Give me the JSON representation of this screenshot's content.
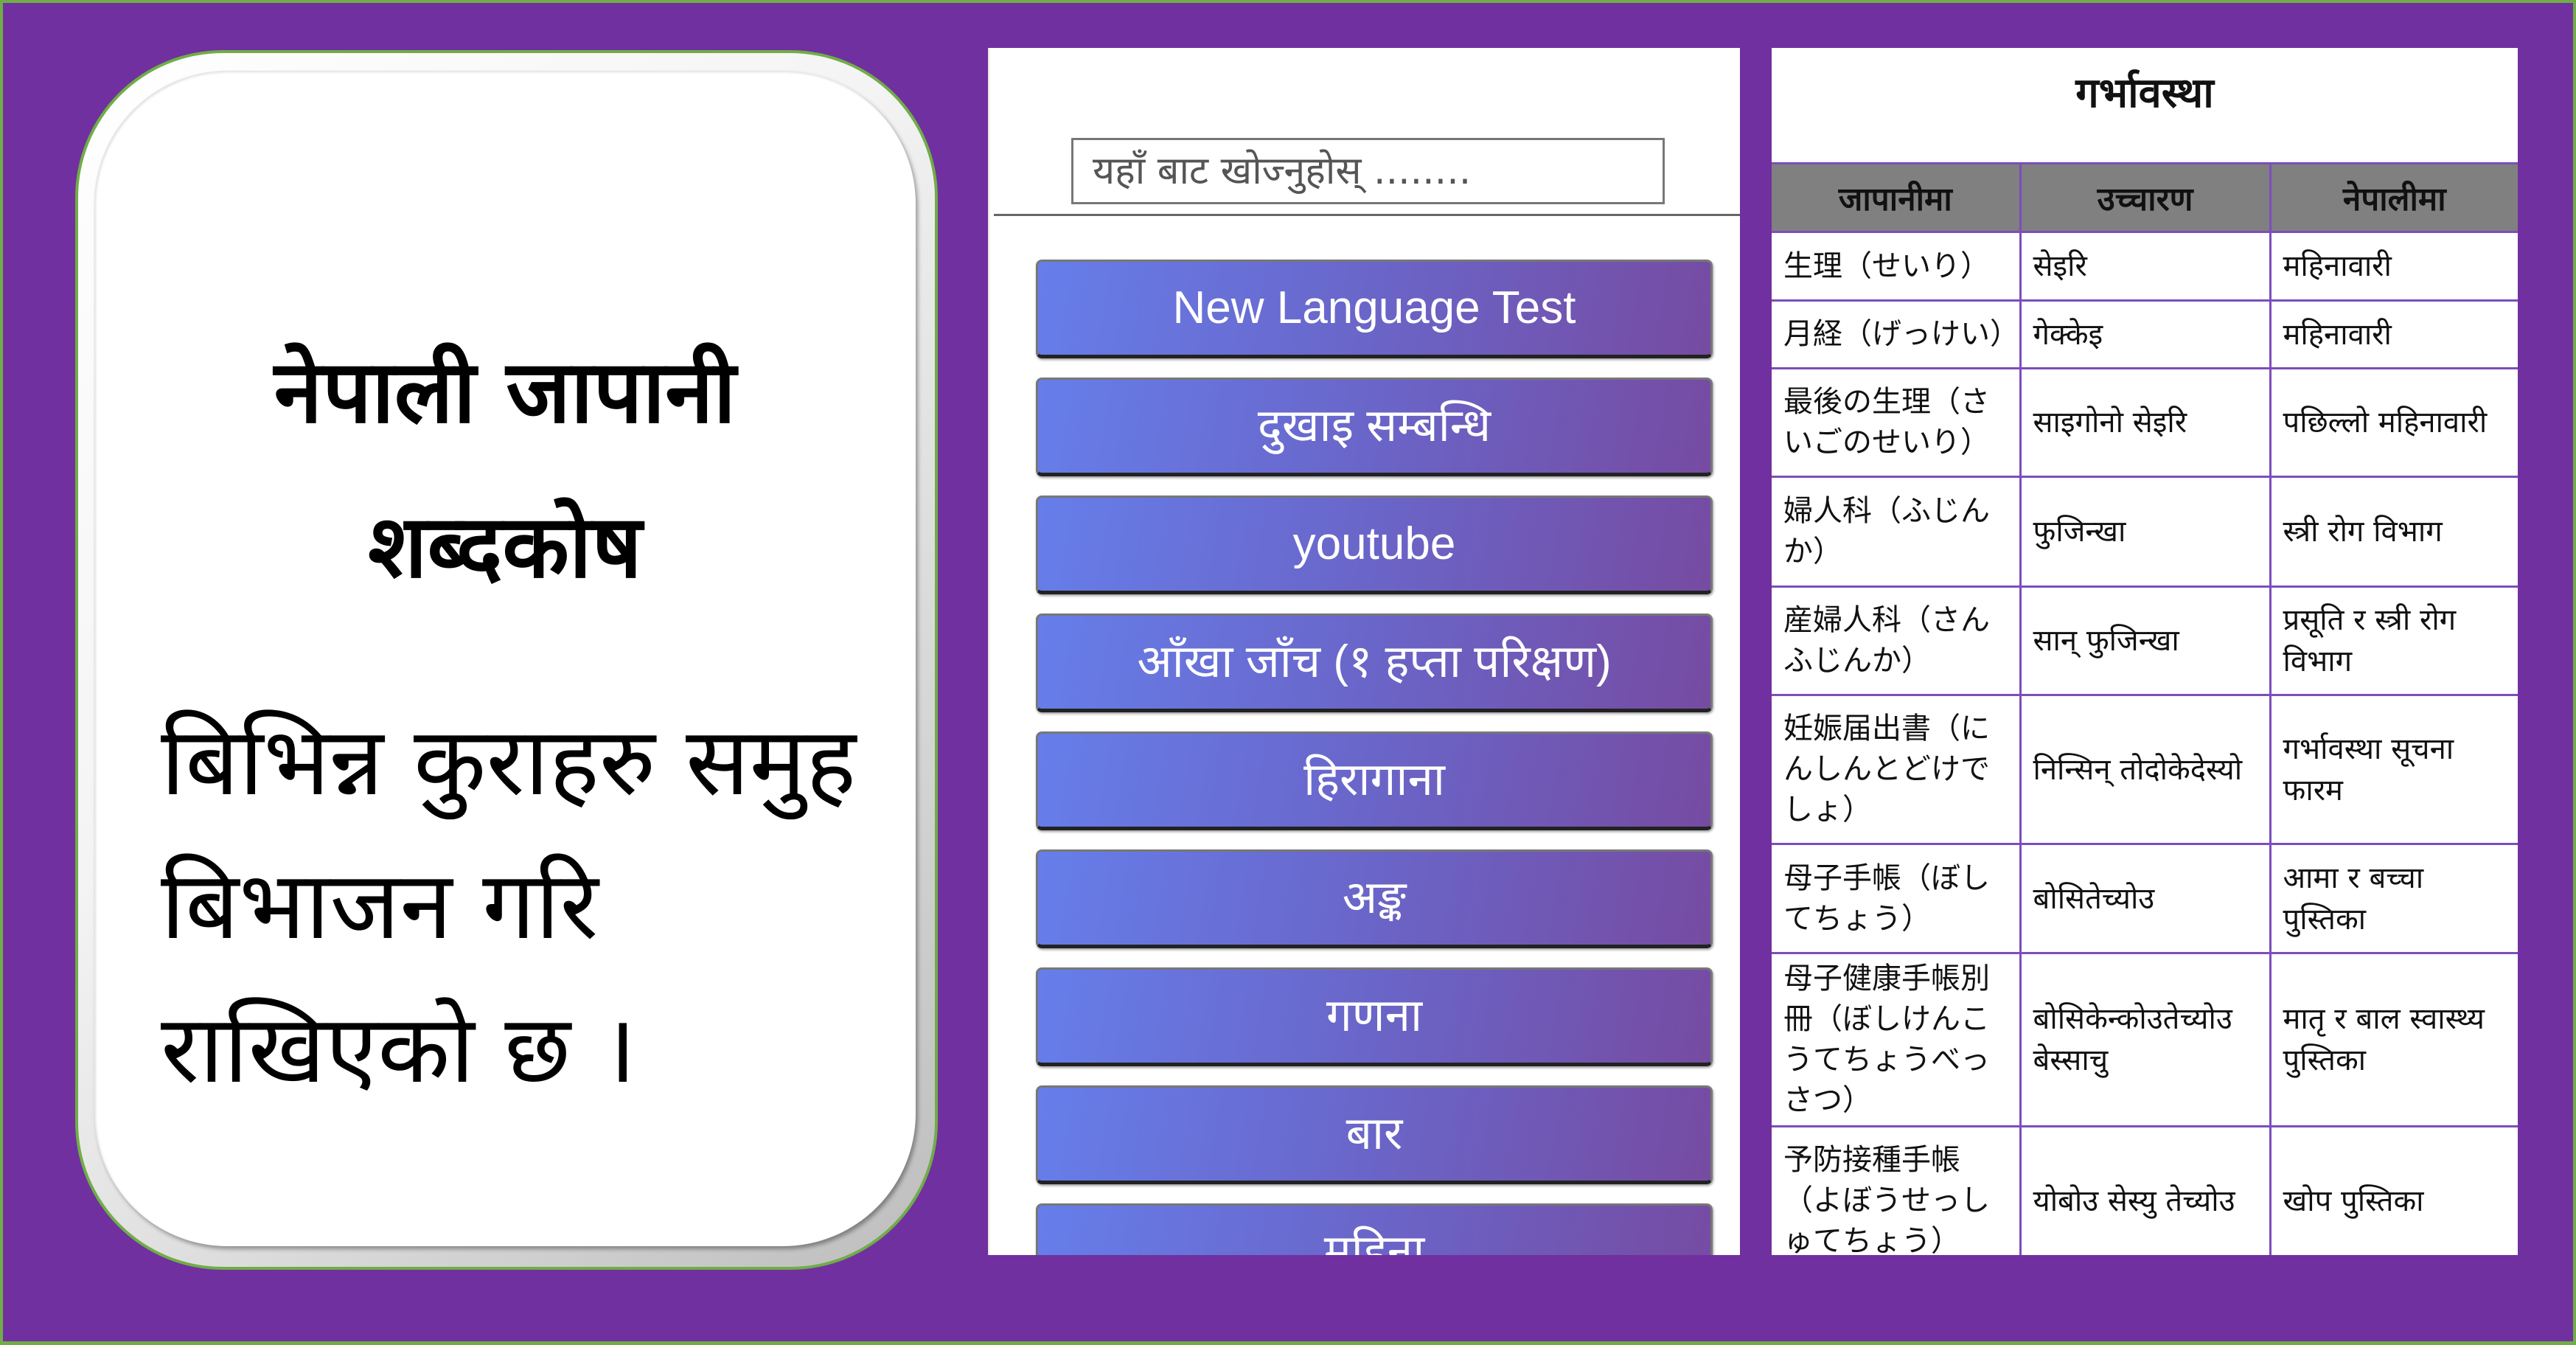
{
  "colors": {
    "frame_border": "#70ad47",
    "background": "#7030a0",
    "button_gradient_start": "#667eea",
    "button_gradient_end": "#764ba2",
    "table_header_bg": "#808080",
    "table_border": "#7c4dbd"
  },
  "promo_card": {
    "title": "नेपाली जापानी शब्दकोष",
    "description": "बिभिन्न कुराहरु समुह बिभाजन गरि राखिएको छ ।"
  },
  "app_screen": {
    "search": {
      "placeholder": "यहाँ बाट खोज्नुहोस् ........",
      "value": ""
    },
    "menu_buttons": [
      {
        "label": "New Language Test"
      },
      {
        "label": "दुखाइ सम्बन्धि"
      },
      {
        "label": "youtube"
      },
      {
        "label": "आँखा जाँच (१ हप्ता परिक्षण)"
      },
      {
        "label": "हिरागाना"
      },
      {
        "label": "अङ्क"
      },
      {
        "label": "गणना"
      },
      {
        "label": "बार"
      },
      {
        "label": "महिना"
      }
    ]
  },
  "vocab_screen": {
    "title": "गर्भावस्था",
    "columns": [
      "जापानीमा",
      "उच्चारण",
      "नेपालीमा"
    ],
    "rows": [
      {
        "japanese": "生理（せいり）",
        "pronunciation": "सेइरि",
        "nepali": "महिनावारी"
      },
      {
        "japanese": "月経（げっけい）",
        "pronunciation": "गेक्केइ",
        "nepali": "महिनावारी"
      },
      {
        "japanese": "最後の生理（さいごのせいり）",
        "pronunciation": "साइगोनो सेइरि",
        "nepali": "पछिल्लो महिनावारी"
      },
      {
        "japanese": "婦人科（ふじんか）",
        "pronunciation": "फुजिन्खा",
        "nepali": "स्त्री रोग विभाग"
      },
      {
        "japanese": "産婦人科（さんふじんか）",
        "pronunciation": "सान् फुजिन्खा",
        "nepali": "प्रसूति र स्त्री रोग विभाग"
      },
      {
        "japanese": "妊娠届出書（にんしんとどけでしょ）",
        "pronunciation": "निन्सिन् तोदोकेदेस्यो",
        "nepali": "गर्भावस्था सूचना फारम"
      },
      {
        "japanese": "母子手帳（ぼしてちょう）",
        "pronunciation": "बोसितेच्योउ",
        "nepali": "आमा र बच्चा पुस्तिका"
      },
      {
        "japanese": "母子健康手帳別冊（ぼしけんこうてちょうべっさつ）",
        "pronunciation": "बोसिकेन्कोउतेच्योउ बेस्साचु",
        "nepali": "मातृ र बाल स्वास्थ्य पुस्तिका"
      },
      {
        "japanese": "予防接種手帳（よぼうせっしゅてちょう）",
        "pronunciation": "योबोउ सेस्यु तेच्योउ",
        "nepali": "खोप पुस्तिका"
      }
    ]
  }
}
